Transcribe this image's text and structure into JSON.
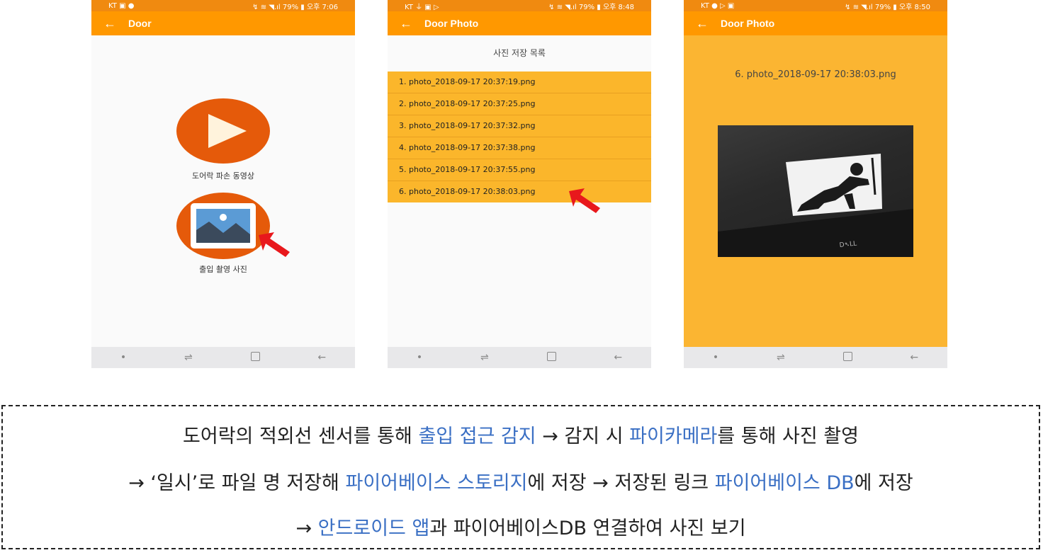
{
  "phone1": {
    "status": {
      "left": "KT ▣ ●",
      "right": "↯ ≋ ◥.ıl 79% ▮ 오후 7:06"
    },
    "title": "Door",
    "video_label": "도어락 파손 동영상",
    "photo_label": "출입 촬영 사진"
  },
  "phone2": {
    "status": {
      "left": "KT ⏚ ▣ ▷",
      "right": "↯ ≋ ◥.ıl 79% ▮ 오후 8:48"
    },
    "title": "Door Photo",
    "list_title": "사진 저장 목록",
    "files": [
      "1. photo_2018-09-17 20:37:19.png",
      "2. photo_2018-09-17 20:37:25.png",
      "3. photo_2018-09-17 20:37:32.png",
      "4. photo_2018-09-17 20:37:38.png",
      "5. photo_2018-09-17 20:37:55.png",
      "6. photo_2018-09-17 20:38:03.png"
    ]
  },
  "phone3": {
    "status": {
      "left": "KT ● ▷ ▣",
      "right": "↯ ≋ ◥.ıl 79% ▮ 오후 8:50"
    },
    "title": "Door Photo",
    "photo_name": "6. photo_2018-09-17 20:38:03.png"
  },
  "navbar": {
    "dot": "•",
    "recents": "⇌",
    "back": "←"
  },
  "back_arrow": "←",
  "description": {
    "line1": [
      "도어락의 적외선 센서를 통해 ",
      "출입 접근 감지",
      " → 감지 시 ",
      "파이카메라",
      "를 통해 사진 촬영"
    ],
    "line2": [
      "→ ‘일시’로 파일 명 저장해 ",
      "파이어베이스 스토리지",
      "에 저장 → 저장된 링크 ",
      "파이어베이스 DB",
      "에 저장"
    ],
    "line3": [
      "→ ",
      "안드로이드 앱",
      "과 파이어베이스DB 연결하여  사진 보기"
    ]
  },
  "colors": {
    "accent": "#ff9800",
    "icon_orange": "#e55a0a",
    "list_bg": "#fbb62b",
    "highlight": "#3a6fc4"
  }
}
